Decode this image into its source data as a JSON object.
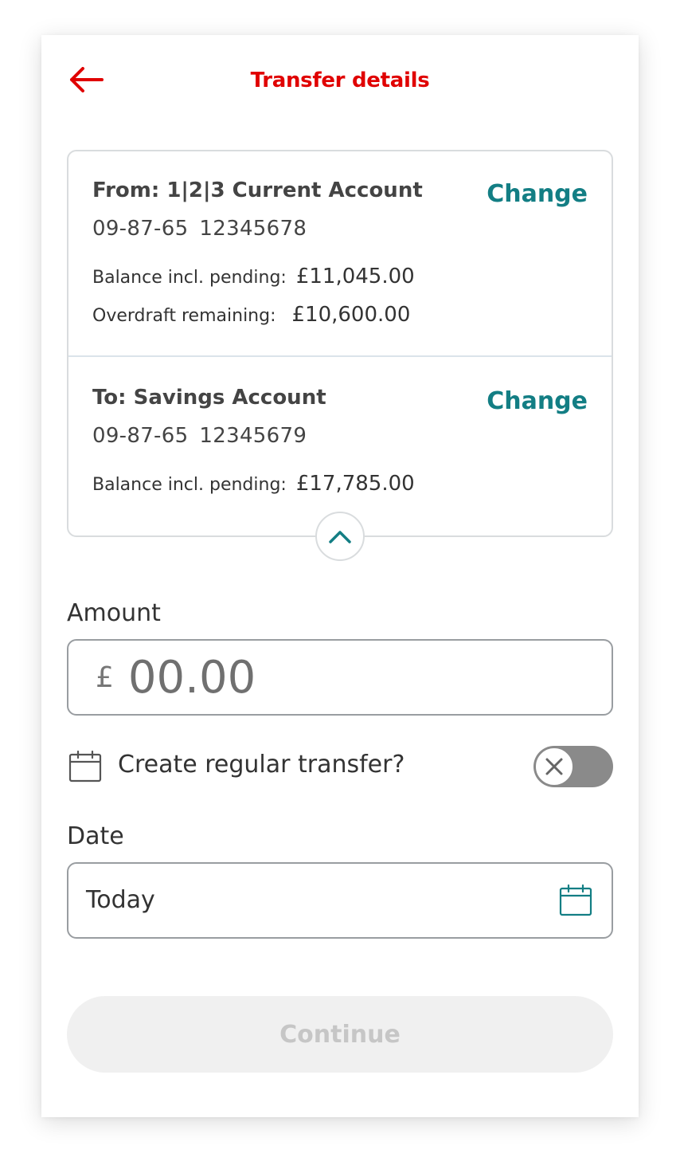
{
  "header": {
    "title": "Transfer details",
    "back_icon": "back-arrow-icon",
    "accent_color": "#e00000"
  },
  "from_account": {
    "name": "From: 1|2|3 Current Account",
    "sort_code": "09-87-65",
    "account_number": "12345678",
    "change_label": "Change",
    "balance_label": "Balance incl. pending:",
    "balance_value": "£11,045.00",
    "overdraft_label": "Overdraft remaining:",
    "overdraft_value": "£10,600.00"
  },
  "to_account": {
    "name": "To: Savings Account",
    "sort_code": "09-87-65",
    "account_number": "12345679",
    "change_label": "Change",
    "balance_label": "Balance incl. pending:",
    "balance_value": "£17,785.00"
  },
  "amount": {
    "label": "Amount",
    "currency": "£",
    "placeholder": "00.00",
    "value": ""
  },
  "regular_transfer": {
    "label": "Create regular transfer?",
    "enabled": false
  },
  "date": {
    "label": "Date",
    "value": "Today"
  },
  "continue_button": {
    "label": "Continue",
    "disabled": true
  },
  "colors": {
    "link": "#137e84",
    "brand_red": "#e00000"
  }
}
